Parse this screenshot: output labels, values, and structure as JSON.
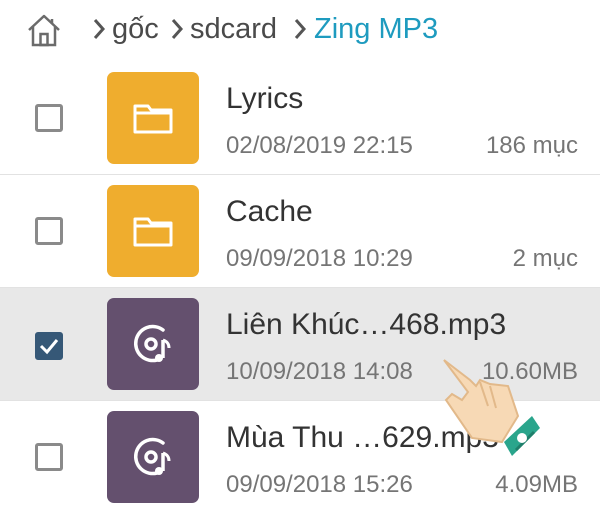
{
  "breadcrumb": {
    "home_icon": "home-icon",
    "items": [
      {
        "label": "gốc"
      },
      {
        "label": "sdcard"
      },
      {
        "label": "Zing MP3",
        "active": true
      }
    ]
  },
  "files": [
    {
      "name": "Lyrics",
      "date": "02/08/2019 22:15",
      "size": "186 mục",
      "type": "folder",
      "checked": false
    },
    {
      "name": "Cache",
      "date": "09/09/2018 10:29",
      "size": "2 mục",
      "type": "folder",
      "checked": false
    },
    {
      "name": "Liên Khúc…468.mp3",
      "date": "10/09/2018 14:08",
      "size": "10.60MB",
      "type": "audio",
      "checked": true
    },
    {
      "name": "Mùa Thu …629.mp3",
      "date": "09/09/2018 15:26",
      "size": "4.09MB",
      "type": "audio",
      "checked": false
    }
  ],
  "colors": {
    "folder": "#efad2e",
    "audio": "#64506e",
    "accent": "#1e9bbf",
    "checkbox_checked": "#365877"
  },
  "overlay_icon": "pointing-hand-icon"
}
